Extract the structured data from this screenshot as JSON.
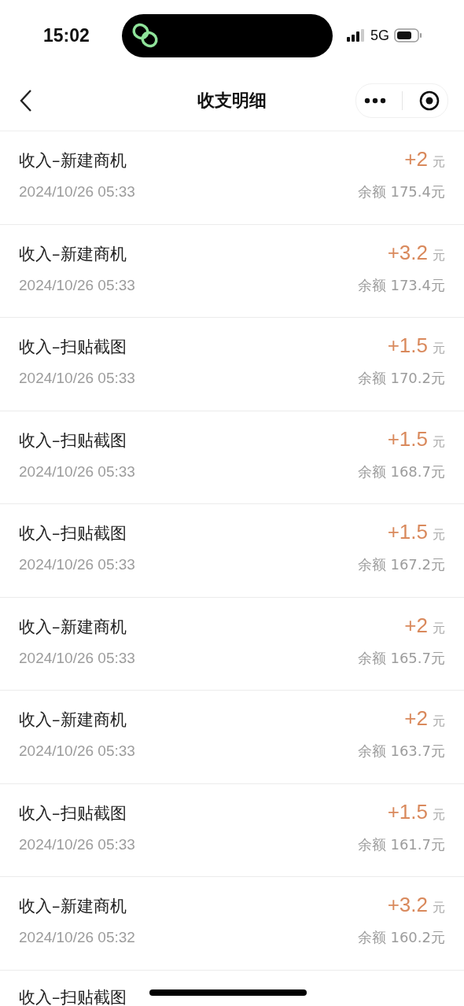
{
  "status_bar": {
    "time": "15:02",
    "network": "5G"
  },
  "nav": {
    "title": "收支明细"
  },
  "rows": [
    {
      "title": "收入–新建商机",
      "amount": "+2",
      "unit": "元",
      "datetime": "2024/10/26 05:33",
      "balance": "余额 175.4元"
    },
    {
      "title": "收入–新建商机",
      "amount": "+3.2",
      "unit": "元",
      "datetime": "2024/10/26 05:33",
      "balance": "余额 173.4元"
    },
    {
      "title": "收入–扫贴截图",
      "amount": "+1.5",
      "unit": "元",
      "datetime": "2024/10/26 05:33",
      "balance": "余额 170.2元"
    },
    {
      "title": "收入–扫贴截图",
      "amount": "+1.5",
      "unit": "元",
      "datetime": "2024/10/26 05:33",
      "balance": "余额 168.7元"
    },
    {
      "title": "收入–扫贴截图",
      "amount": "+1.5",
      "unit": "元",
      "datetime": "2024/10/26 05:33",
      "balance": "余额 167.2元"
    },
    {
      "title": "收入–新建商机",
      "amount": "+2",
      "unit": "元",
      "datetime": "2024/10/26 05:33",
      "balance": "余额 165.7元"
    },
    {
      "title": "收入–新建商机",
      "amount": "+2",
      "unit": "元",
      "datetime": "2024/10/26 05:33",
      "balance": "余额 163.7元"
    },
    {
      "title": "收入–扫贴截图",
      "amount": "+1.5",
      "unit": "元",
      "datetime": "2024/10/26 05:33",
      "balance": "余额 161.7元"
    },
    {
      "title": "收入–新建商机",
      "amount": "+3.2",
      "unit": "元",
      "datetime": "2024/10/26 05:32",
      "balance": "余额 160.2元"
    },
    {
      "title": "收入–扫贴截图"
    }
  ]
}
